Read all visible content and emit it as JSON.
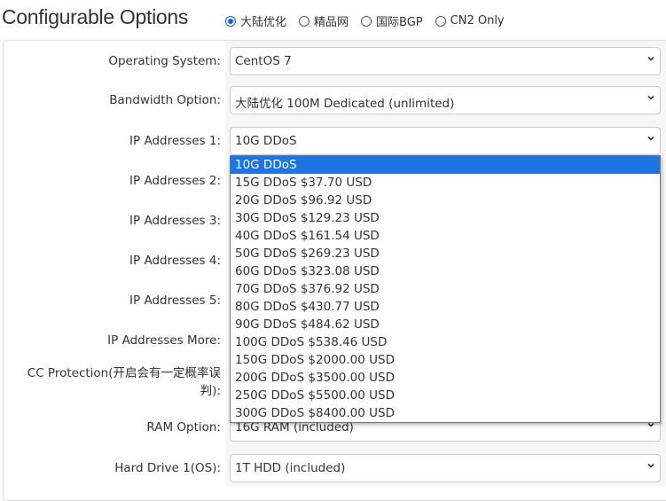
{
  "title": "Configurable Options",
  "regions": [
    {
      "label": "大陆优化",
      "selected": true
    },
    {
      "label": "精品网",
      "selected": false
    },
    {
      "label": "国际BGP",
      "selected": false
    },
    {
      "label": "CN2 Only",
      "selected": false
    }
  ],
  "fields": [
    {
      "label": "Operating System:",
      "value": "CentOS 7"
    },
    {
      "label": "Bandwidth Option:",
      "value": "大陆优化 100M Dedicated (unlimited)"
    },
    {
      "label": "IP Addresses 1:",
      "value": "10G DDoS"
    },
    {
      "label": "IP Addresses 2:",
      "value": ""
    },
    {
      "label": "IP Addresses 3:",
      "value": ""
    },
    {
      "label": "IP Addresses 4:",
      "value": ""
    },
    {
      "label": "IP Addresses 5:",
      "value": ""
    },
    {
      "label": "IP Addresses More:",
      "value": ""
    },
    {
      "label": "CC Protection(开启会有一定概率误判):",
      "value": ""
    },
    {
      "label": "RAM Option:",
      "value": "16G RAM (included)"
    },
    {
      "label": "Hard Drive 1(OS):",
      "value": "1T HDD (included)"
    }
  ],
  "dropdown_options": [
    "10G DDoS",
    "15G DDoS $37.70 USD",
    "20G DDoS $96.92 USD",
    "30G DDoS $129.23 USD",
    "40G DDoS $161.54 USD",
    "50G DDoS $269.23 USD",
    "60G DDoS $323.08 USD",
    "70G DDoS $376.92 USD",
    "80G DDoS $430.77 USD",
    "90G DDoS $484.62 USD",
    "100G DDoS $538.46 USD",
    "150G DDoS $2000.00 USD",
    "200G DDoS $3500.00 USD",
    "250G DDoS $5500.00 USD",
    "300G DDoS $8400.00 USD"
  ],
  "dropdown_highlighted": 0,
  "accent": "#1e74e0"
}
